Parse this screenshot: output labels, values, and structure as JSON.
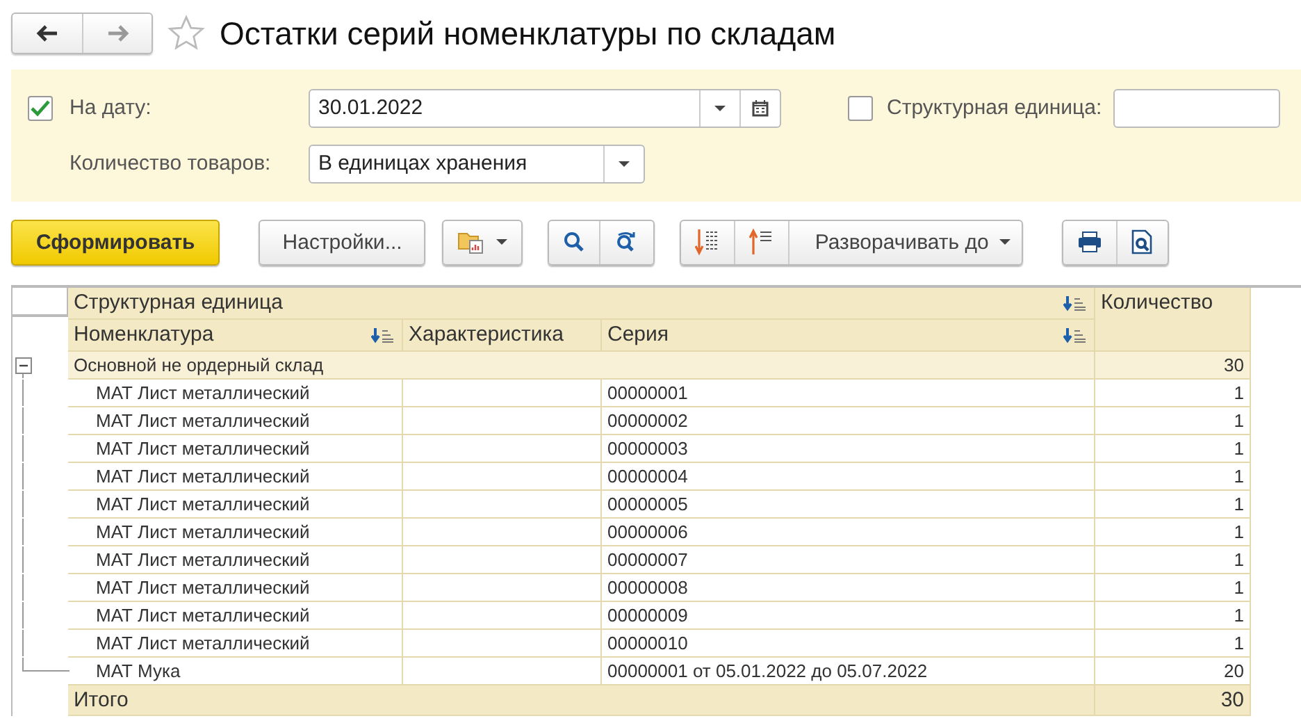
{
  "title": "Остатки серий номенклатуры по складам",
  "filters": {
    "date": {
      "checked": true,
      "label": "На дату:",
      "value": "30.01.2022"
    },
    "unit": {
      "checked": false,
      "label": "Структурная единица:"
    },
    "quantity": {
      "label": "Количество товаров:",
      "value": "В единицах хранения"
    }
  },
  "toolbar": {
    "generate": "Сформировать",
    "settings": "Настройки...",
    "expand": "Разворачивать до"
  },
  "table": {
    "group_header": "Структурная единица",
    "columns": [
      "Номенклатура",
      "Характеристика",
      "Серия",
      "Количество"
    ],
    "groups": [
      {
        "name": "Основной не ордерный склад",
        "total": "30",
        "expanded": true,
        "rows": [
          {
            "item": "МАТ Лист металлический",
            "series": "00000001",
            "quantity": "1"
          },
          {
            "item": "МАТ Лист металлический",
            "series": "00000002",
            "quantity": "1"
          },
          {
            "item": "МАТ Лист металлический",
            "series": "00000003",
            "quantity": "1"
          },
          {
            "item": "МАТ Лист металлический",
            "series": "00000004",
            "quantity": "1"
          },
          {
            "item": "МАТ Лист металлический",
            "series": "00000005",
            "quantity": "1"
          },
          {
            "item": "МАТ Лист металлический",
            "series": "00000006",
            "quantity": "1"
          },
          {
            "item": "МАТ Лист металлический",
            "series": "00000007",
            "quantity": "1"
          },
          {
            "item": "МАТ Лист металлический",
            "series": "00000008",
            "quantity": "1"
          },
          {
            "item": "МАТ Лист металлический",
            "series": "00000009",
            "quantity": "1"
          },
          {
            "item": "МАТ Лист металлический",
            "series": "00000010",
            "quantity": "1"
          },
          {
            "item": "МАТ Мука",
            "series": "00000001 от 05.01.2022 до 05.07.2022",
            "quantity": "20"
          }
        ]
      }
    ],
    "total_label": "Итого",
    "total": "30"
  }
}
